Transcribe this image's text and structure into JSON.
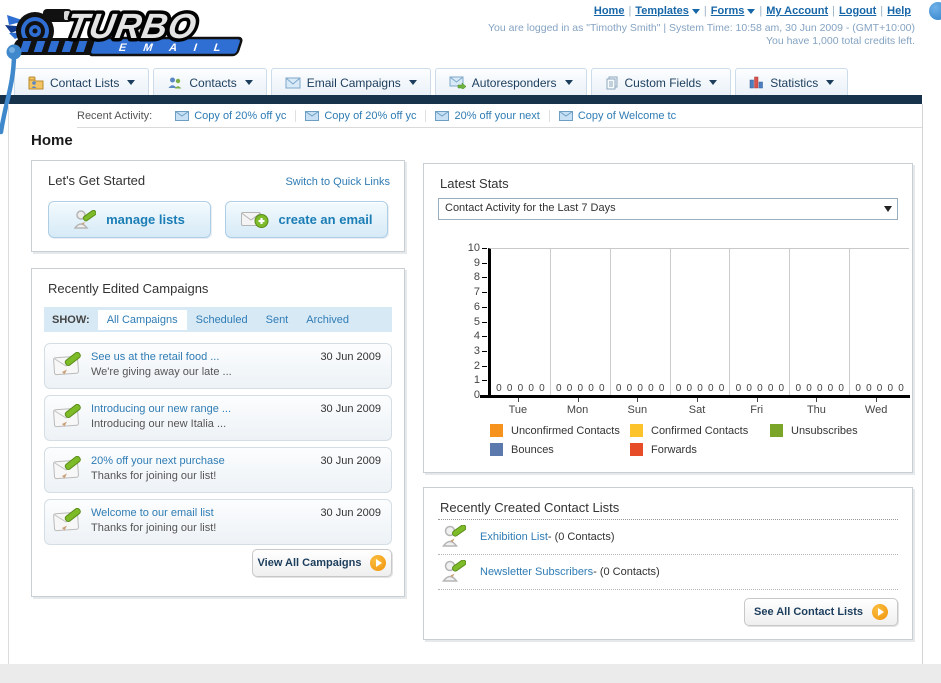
{
  "logo": {
    "brand": "TURBO",
    "sub": "E M A I L"
  },
  "header": {
    "links": [
      {
        "label": "Home"
      },
      {
        "label": "Templates"
      },
      {
        "label": "Forms"
      },
      {
        "label": "My Account"
      },
      {
        "label": "Logout"
      },
      {
        "label": "Help"
      }
    ],
    "separator": "|",
    "login_line1": "You are logged in as \"Timothy Smith\" | System Time: 10:58 am, 30 Jun 2009 - (GMT+10:00)",
    "login_line2": "You have 1,000 total credits left."
  },
  "nav": {
    "tabs": [
      {
        "label": "Contact Lists",
        "icon": "folder-user-icon"
      },
      {
        "label": "Contacts",
        "icon": "people-icon"
      },
      {
        "label": "Email Campaigns",
        "icon": "envelope-icon"
      },
      {
        "label": "Autoresponders",
        "icon": "envelope-arrow-icon"
      },
      {
        "label": "Custom Fields",
        "icon": "pages-icon"
      },
      {
        "label": "Statistics",
        "icon": "bar-chart-icon"
      }
    ]
  },
  "recent_activity": {
    "label": "Recent Activity:",
    "items": [
      {
        "label": "Copy of 20% off yc"
      },
      {
        "label": "Copy of 20% off yc"
      },
      {
        "label": "20% off your next"
      },
      {
        "label": "Copy of Welcome tc"
      }
    ]
  },
  "page": {
    "title": "Home"
  },
  "get_started": {
    "title": "Let's Get Started",
    "switch_link": "Switch to Quick Links",
    "manage_lists_label": "manage lists",
    "create_email_label": "create an email"
  },
  "campaigns": {
    "title": "Recently Edited Campaigns",
    "show_label": "SHOW:",
    "tabs": [
      {
        "label": "All Campaigns",
        "active": true
      },
      {
        "label": "Scheduled",
        "active": false
      },
      {
        "label": "Sent",
        "active": false
      },
      {
        "label": "Archived",
        "active": false
      }
    ],
    "items": [
      {
        "title": "See us at the retail food ...",
        "subtitle": "We're giving away our late ...",
        "date": "30 Jun 2009"
      },
      {
        "title": "Introducing our new range ...",
        "subtitle": "Introducing our new Italia ...",
        "date": "30 Jun 2009"
      },
      {
        "title": "20% off your next purchase",
        "subtitle": "Thanks for joining our list!",
        "date": "30 Jun 2009"
      },
      {
        "title": "Welcome to our email list",
        "subtitle": "Thanks for joining our list!",
        "date": "30 Jun 2009"
      }
    ],
    "view_all_label": "View All Campaigns"
  },
  "stats": {
    "title": "Latest Stats",
    "dropdown_value": "Contact Activity for the Last 7 Days",
    "chart_data": {
      "type": "bar",
      "title": "Contact Activity for the Last 7 Days",
      "categories": [
        "Tue",
        "Mon",
        "Sun",
        "Sat",
        "Fri",
        "Thu",
        "Wed"
      ],
      "series": [
        {
          "name": "Unconfirmed Contacts",
          "color": "#F6921E",
          "values": [
            0,
            0,
            0,
            0,
            0,
            0,
            0
          ]
        },
        {
          "name": "Confirmed Contacts",
          "color": "#FCC32C",
          "values": [
            0,
            0,
            0,
            0,
            0,
            0,
            0
          ]
        },
        {
          "name": "Unsubscribes",
          "color": "#7BA529",
          "values": [
            0,
            0,
            0,
            0,
            0,
            0,
            0
          ]
        },
        {
          "name": "Bounces",
          "color": "#5C79AE",
          "values": [
            0,
            0,
            0,
            0,
            0,
            0,
            0
          ]
        },
        {
          "name": "Forwards",
          "color": "#E74C28",
          "values": [
            0,
            0,
            0,
            0,
            0,
            0,
            0
          ]
        }
      ],
      "ylim": [
        0,
        10
      ],
      "ytick_step": 1,
      "grid": "vertical-only",
      "value_labels_shown": true,
      "legend_position": "bottom"
    }
  },
  "contact_lists": {
    "title": "Recently Created Contact Lists",
    "items": [
      {
        "name": "Exhibition List",
        "suffix": " - (0 Contacts)"
      },
      {
        "name": "Newsletter Subscribers",
        "suffix": " - (0 Contacts)"
      }
    ],
    "see_all_label": "See All Contact Lists"
  },
  "colors": {
    "navy_bar": "#16334B",
    "link_blue": "#2F7CB4",
    "header_link": "#1766A8",
    "button_text": "#1B7DB5",
    "orange_accent": "#F0920C"
  }
}
